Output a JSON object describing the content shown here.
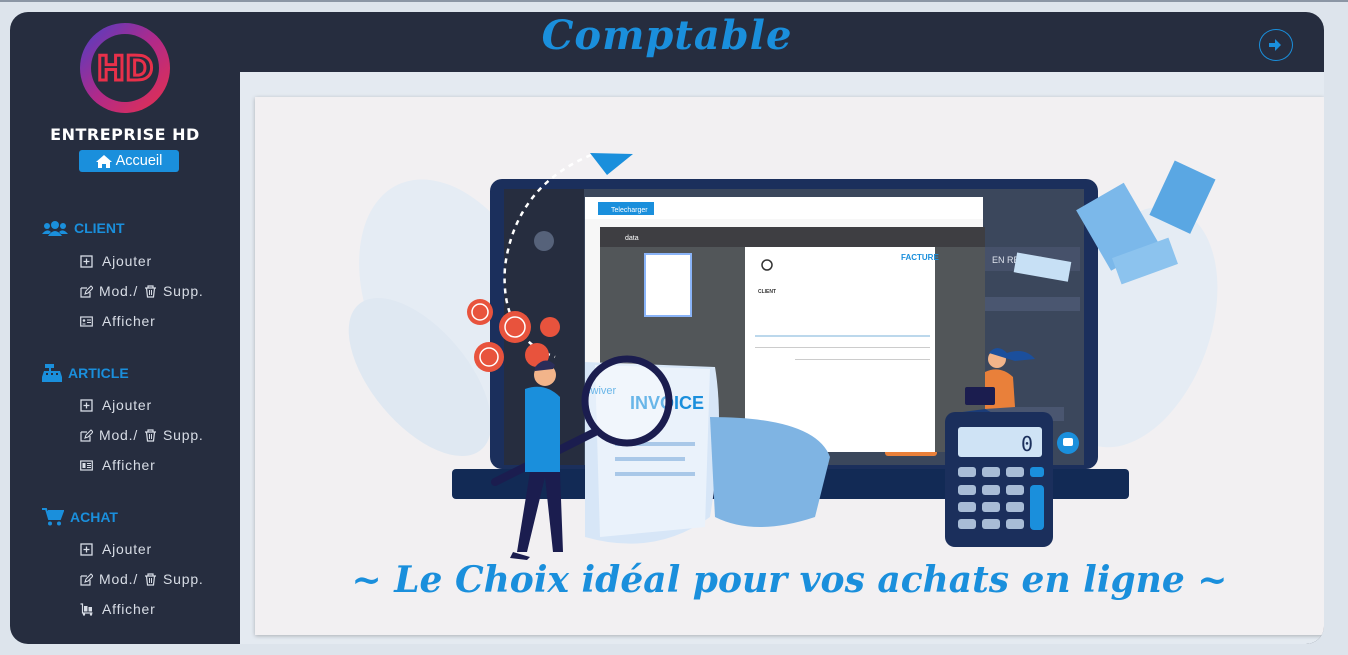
{
  "app": {
    "title": "Comptable",
    "company": "ENTREPRISE HD",
    "logo_text": "HD",
    "home_label": "Accueil"
  },
  "sidebar": {
    "sections": [
      {
        "label": "CLIENT",
        "icon": "users-icon",
        "items": [
          {
            "label": "Ajouter",
            "icon": "plus-square-icon"
          },
          {
            "label": "Mod./",
            "label2": "Supp.",
            "icon": "edit-icon",
            "icon2": "trash-icon"
          },
          {
            "label": "Afficher",
            "icon": "id-card-icon"
          }
        ]
      },
      {
        "label": "ARTICLE",
        "icon": "cash-register-icon",
        "items": [
          {
            "label": "Ajouter",
            "icon": "plus-square-icon"
          },
          {
            "label": "Mod./",
            "label2": "Supp.",
            "icon": "edit-icon",
            "icon2": "trash-icon"
          },
          {
            "label": "Afficher",
            "icon": "list-card-icon"
          }
        ]
      },
      {
        "label": "ACHAT",
        "icon": "shopping-cart-icon",
        "items": [
          {
            "label": "Ajouter",
            "icon": "plus-square-icon"
          },
          {
            "label": "Mod./",
            "label2": "Supp.",
            "icon": "edit-icon",
            "icon2": "trash-icon"
          },
          {
            "label": "Afficher",
            "icon": "luggage-cart-icon"
          }
        ]
      }
    ]
  },
  "banner": {
    "slogan": "~ Le Choix idéal pour vos achats en ligne ~",
    "brand": "swiver",
    "invoice_word": "INVOICE",
    "doc_heading": "FACTURE",
    "doc_client": "CLIENT",
    "doc_title": "data",
    "download_label": "Telecharger",
    "late_label": "EN RETARD",
    "calc_display": "0"
  },
  "colors": {
    "accent": "#1a8fdc",
    "frame": "#262d3f",
    "content_bg": "#e4eaf1"
  }
}
